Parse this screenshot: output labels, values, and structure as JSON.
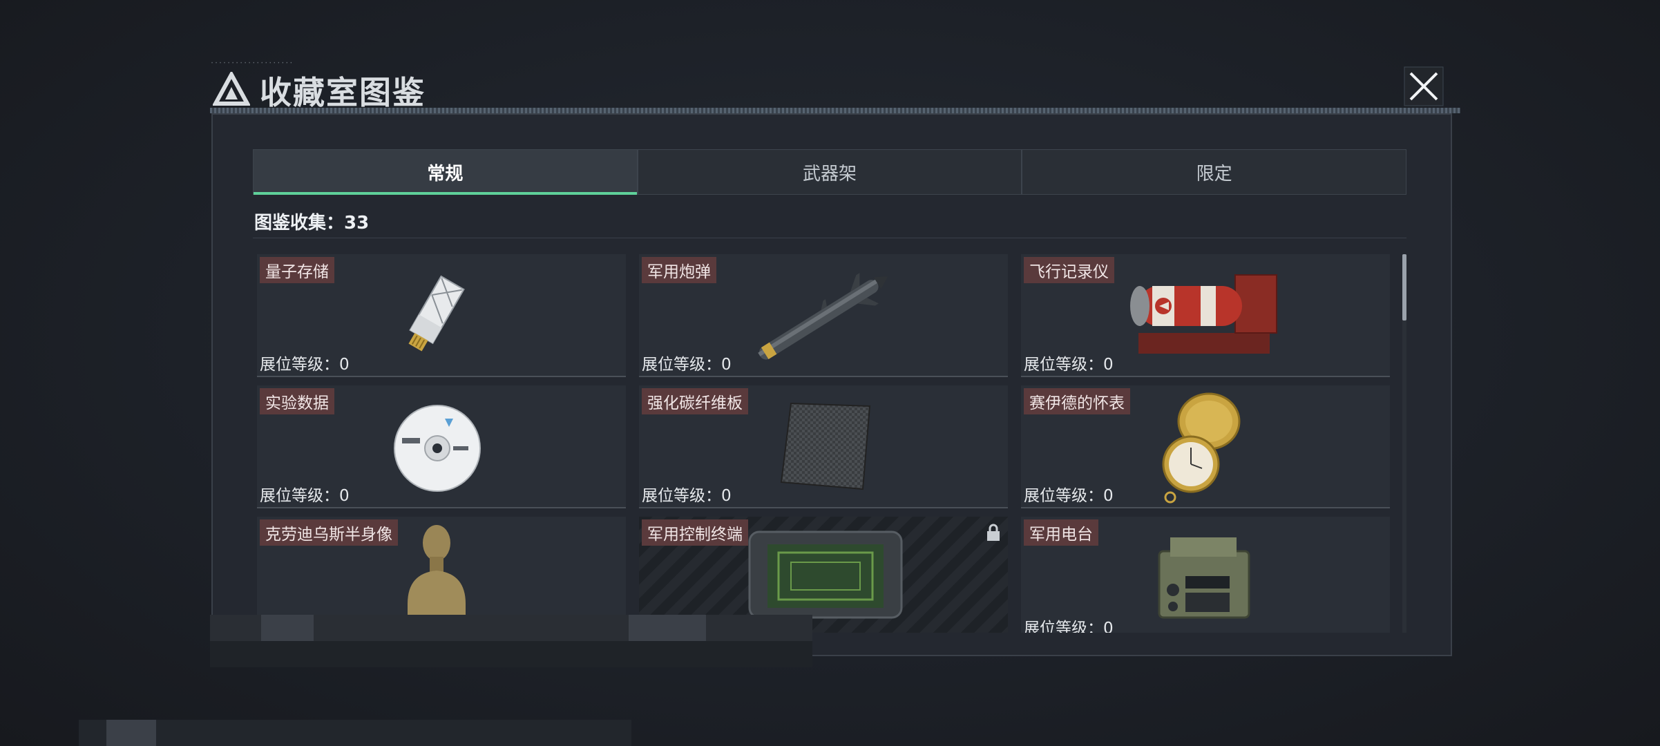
{
  "title": {
    "text": "收藏室图鉴"
  },
  "tabs": [
    {
      "label": "常规",
      "active": true
    },
    {
      "label": "武器架",
      "active": false
    },
    {
      "label": "限定",
      "active": false
    }
  ],
  "collection": {
    "label": "图鉴收集：33"
  },
  "items": [
    {
      "name": "量子存储",
      "level": "展位等级：0",
      "icon": "usb-drive-icon"
    },
    {
      "name": "军用炮弹",
      "level": "展位等级：0",
      "icon": "missile-icon"
    },
    {
      "name": "飞行记录仪",
      "level": "展位等级：0",
      "icon": "flight-recorder-icon"
    },
    {
      "name": "实验数据",
      "level": "展位等级：0",
      "icon": "disc-icon"
    },
    {
      "name": "强化碳纤维板",
      "level": "展位等级：0",
      "icon": "carbon-plate-icon"
    },
    {
      "name": "赛伊德的怀表",
      "level": "展位等级：0",
      "icon": "pocket-watch-icon"
    },
    {
      "name": "克劳迪乌斯半身像",
      "level": "",
      "icon": "bust-icon"
    },
    {
      "name": "军用控制终端",
      "level": "",
      "icon": "control-terminal-icon",
      "locked": true
    },
    {
      "name": "军用电台",
      "level": "展位等级：0",
      "icon": "radio-icon"
    }
  ],
  "colors": {
    "accent": "#5fd19a",
    "name_tag": "#5a3a3c",
    "panel": "#242830"
  },
  "scroll": {
    "position": 0
  }
}
